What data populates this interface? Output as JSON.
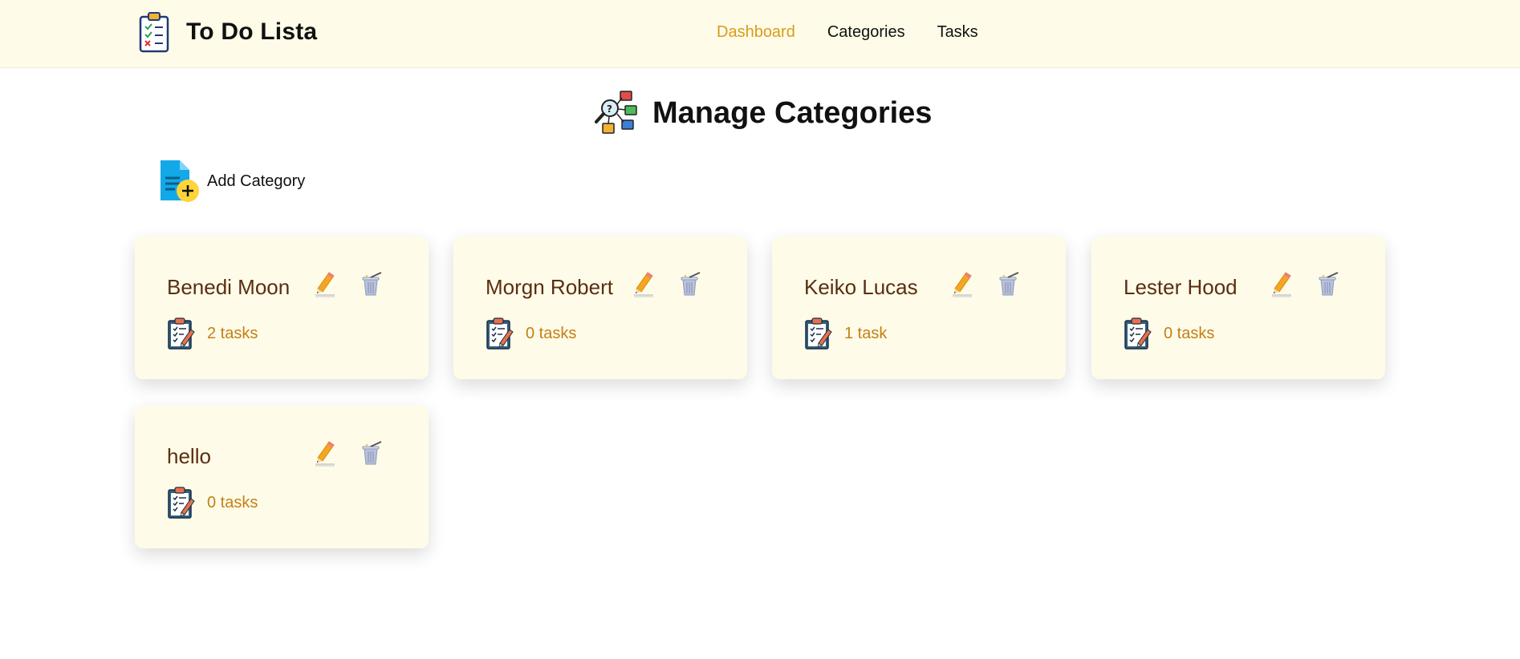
{
  "app": {
    "title": "To Do Lista"
  },
  "nav": {
    "items": [
      {
        "label": "Dashboard",
        "active": true
      },
      {
        "label": "Categories",
        "active": false
      },
      {
        "label": "Tasks",
        "active": false
      }
    ]
  },
  "page": {
    "title": "Manage Categories",
    "add_label": "Add Category"
  },
  "categories": [
    {
      "name": "Benedi Moon",
      "count_label": "2 tasks"
    },
    {
      "name": "Morgn Robert",
      "count_label": "0 tasks"
    },
    {
      "name": "Keiko Lucas",
      "count_label": "1 task"
    },
    {
      "name": "Lester Hood",
      "count_label": "0 tasks"
    },
    {
      "name": "hello",
      "count_label": "0 tasks"
    }
  ],
  "icons": {
    "brand": "clipboard-checklist-icon",
    "heading": "category-search-icon",
    "add": "add-document-icon",
    "edit": "pencil-icon",
    "delete": "trash-icon",
    "tasks": "clipboard-pencil-icon"
  },
  "colors": {
    "nav_active": "#d99b1c",
    "header_bg": "#fefce8",
    "card_bg": "#fefce8",
    "card_title": "#5a2e12",
    "task_count": "#c47f16"
  }
}
